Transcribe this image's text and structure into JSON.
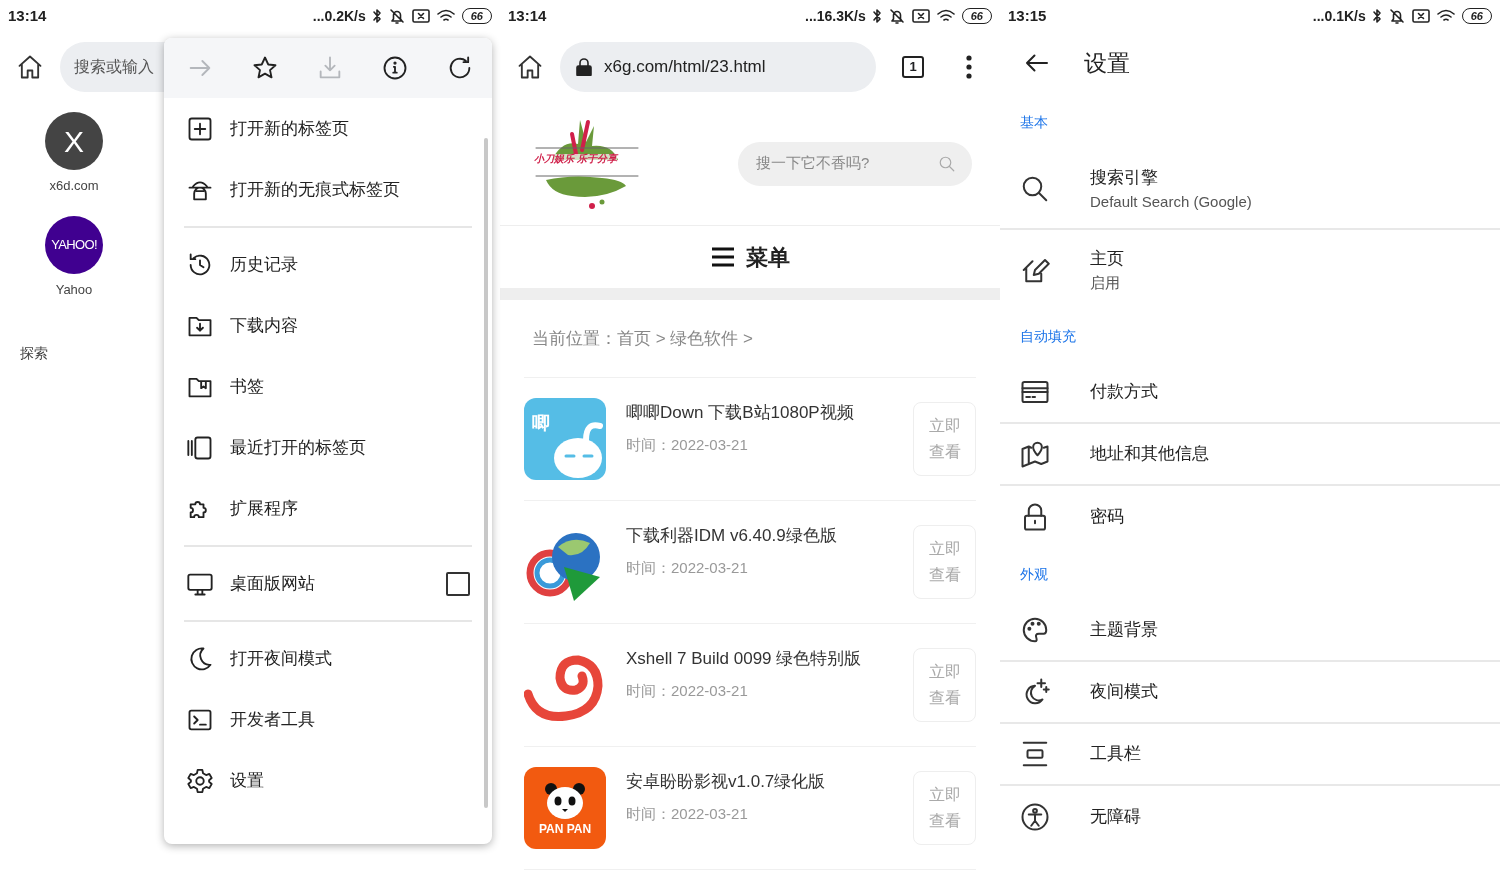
{
  "panels": [
    {
      "kind": "home",
      "status": {
        "time": "13:14",
        "speed": "...0.2K/s",
        "battery": "66"
      },
      "search": {
        "placeholder": "搜索或输入"
      },
      "shortcuts": [
        {
          "kind": "letter",
          "logo": "X",
          "label": "x6d.com"
        },
        {
          "kind": "yahoo",
          "logo": "YAHOO!",
          "label": "Yahoo"
        }
      ],
      "section": "探索",
      "menu": {
        "toolbar": [
          {
            "disabled": true
          },
          {
            "disabled": false
          },
          {
            "disabled": true
          },
          {
            "disabled": false
          },
          {
            "disabled": false
          }
        ],
        "groups": [
          [
            {
              "label": "打开新的标签页"
            },
            {
              "label": "打开新的无痕式标签页"
            }
          ],
          [
            {
              "label": "历史记录"
            },
            {
              "label": "下载内容"
            },
            {
              "label": "书签"
            },
            {
              "label": "最近打开的标签页"
            },
            {
              "label": "扩展程序"
            }
          ],
          [
            {
              "label": "桌面版网站",
              "checked": false
            }
          ],
          [
            {
              "label": "打开夜间模式"
            },
            {
              "label": "开发者工具"
            },
            {
              "label": "设置"
            }
          ]
        ]
      }
    },
    {
      "kind": "browser",
      "status": {
        "time": "13:14",
        "speed": "...16.3K/s",
        "battery": "66"
      },
      "url": "x6g.com/html/23.html",
      "tab_count": "1",
      "site": {
        "logo_text": "小刀娱乐 乐于分享",
        "search_placeholder": "搜一下它不香吗?",
        "menu_label": "菜单",
        "breadcrumb": "当前位置：首页 > 绿色软件 >",
        "articles": [
          {
            "kind": "rabbit",
            "icon_text": "唧",
            "title": "唧唧Down 下载B站1080P视频",
            "date": "时间：2022-03-21",
            "button": "立即查看"
          },
          {
            "kind": "globe",
            "title": "下载利器IDM v6.40.9绿色版",
            "date": "时间：2022-03-21",
            "button": "立即查看"
          },
          {
            "kind": "spiral",
            "title": "Xshell 7 Build 0099 绿色特别版",
            "date": "时间：2022-03-21",
            "button": "立即查看"
          },
          {
            "kind": "panda",
            "icon_text": "PAN PAN",
            "title": "安卓盼盼影视v1.0.7绿化版",
            "date": "时间：2022-03-21",
            "button": "立即查看"
          }
        ]
      }
    },
    {
      "kind": "settings",
      "status": {
        "time": "13:15",
        "speed": "...0.1K/s",
        "battery": "66"
      },
      "title": "设置",
      "sections": [
        {
          "label": "基本",
          "items": [
            {
              "label": "搜索引擎",
              "summary": "Default Search (Google)"
            },
            {
              "label": "主页",
              "summary": "启用"
            }
          ]
        },
        {
          "label": "自动填充",
          "items": [
            {
              "label": "付款方式"
            },
            {
              "label": "地址和其他信息"
            },
            {
              "label": "密码"
            }
          ]
        },
        {
          "label": "外观",
          "items": [
            {
              "label": "主题背景"
            },
            {
              "label": "夜间模式"
            },
            {
              "label": "工具栏"
            },
            {
              "label": "无障碍"
            }
          ]
        }
      ]
    }
  ]
}
